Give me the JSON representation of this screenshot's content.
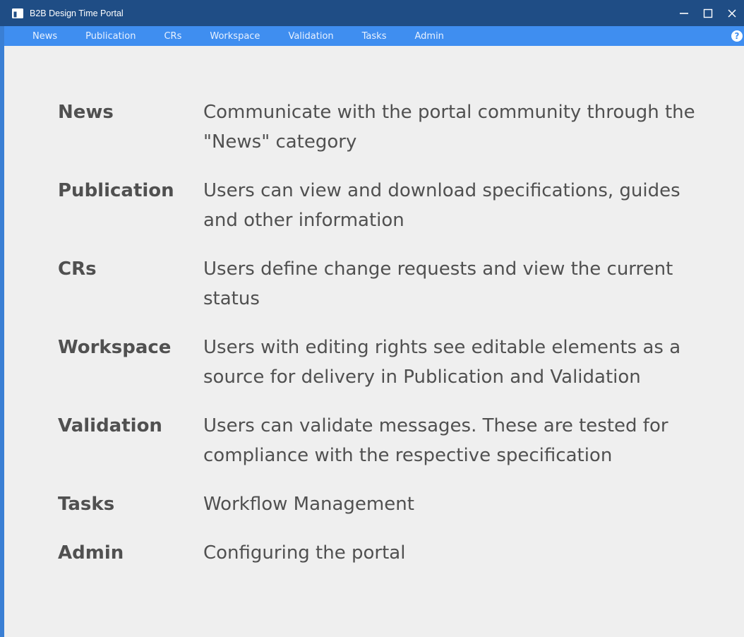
{
  "window": {
    "title": "B2B Design Time Portal",
    "icon": "window-app-icon",
    "controls": [
      "minimize-icon",
      "maximize-icon",
      "close-icon"
    ]
  },
  "menu": {
    "items": [
      {
        "label": "News"
      },
      {
        "label": "Publication"
      },
      {
        "label": "CRs"
      },
      {
        "label": "Workspace"
      },
      {
        "label": "Validation"
      },
      {
        "label": "Tasks"
      },
      {
        "label": "Admin"
      }
    ],
    "help_label": "?"
  },
  "content": {
    "rows": [
      {
        "term": "News",
        "description": "Communicate with the portal community through the \"News\" category"
      },
      {
        "term": "Publication",
        "description": "Users can view and download specifications, guides and other information"
      },
      {
        "term": "CRs",
        "description": "Users define change requests and view the current status"
      },
      {
        "term": "Workspace",
        "description": "Users with editing rights see editable elements as a source for delivery in Publication and Validation"
      },
      {
        "term": "Validation",
        "description": "Users can validate messages. These are tested for compliance with the respective specification"
      },
      {
        "term": "Tasks",
        "description": "Workflow Management"
      },
      {
        "term": "Admin",
        "description": "Configuring the portal"
      }
    ]
  },
  "colors": {
    "titlebar": "#1f4d85",
    "menubar": "#3f8ef0",
    "background": "#efefef",
    "text": "#505050"
  }
}
